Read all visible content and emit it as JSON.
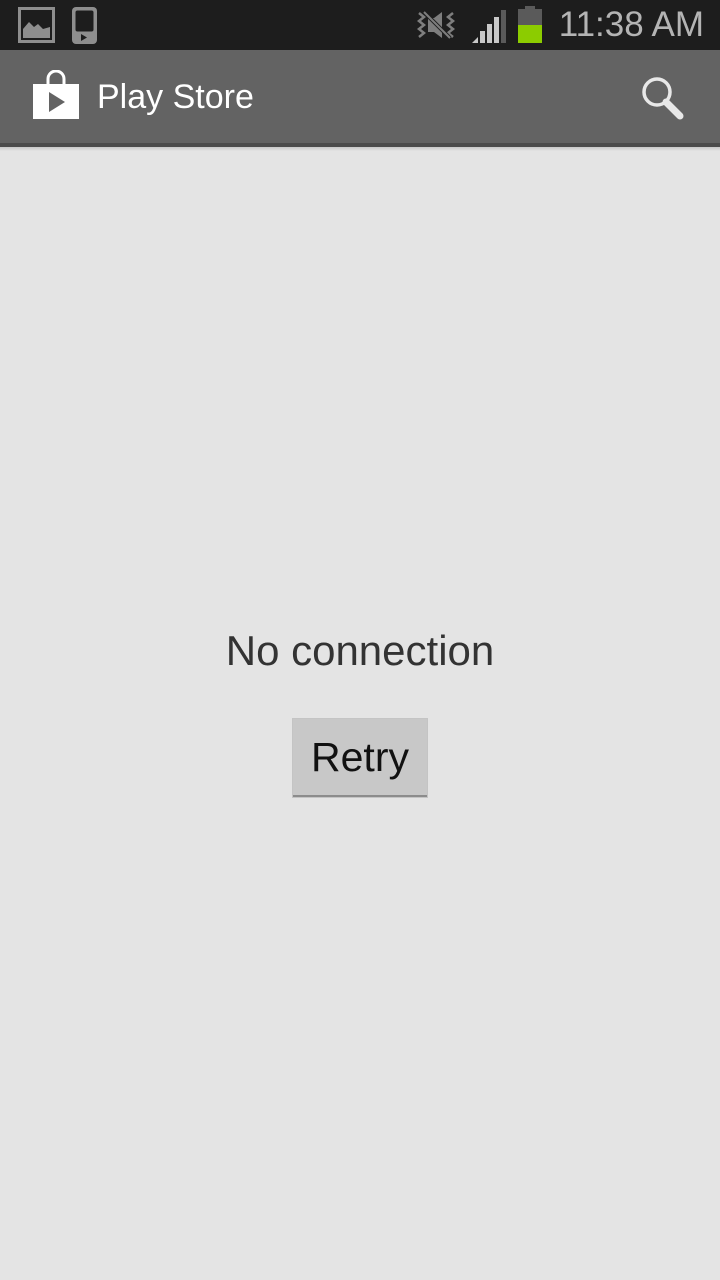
{
  "status_bar": {
    "notification_icons": [
      "gallery-icon",
      "device-media-icon"
    ],
    "system_icons": [
      "mute-vibrate-icon",
      "signal-icon",
      "battery-icon"
    ],
    "battery_color": "#8ccc00",
    "time": "11:38 AM"
  },
  "action_bar": {
    "app_icon": "play-store-bag-icon",
    "title": "Play Store",
    "search_icon": "search-icon"
  },
  "main": {
    "message": "No connection",
    "retry_label": "Retry"
  },
  "colors": {
    "status_bar_bg": "#1d1d1d",
    "action_bar_bg": "#636363",
    "content_bg": "#e4e4e4",
    "button_bg": "#c8c8c8"
  }
}
